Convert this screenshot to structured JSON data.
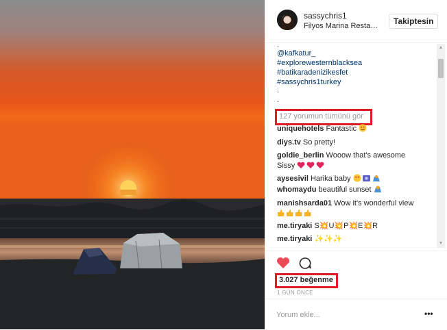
{
  "header": {
    "username": "sassychris1",
    "location": "Filyos Marina Restaurant",
    "follow_label": "Takiptesin"
  },
  "caption": {
    "lines": [
      ".",
      "@kafkatur_",
      "#explorewesternblacksea",
      "#batikaradenizikesfet",
      "#sassychris1turkey",
      ".",
      "."
    ]
  },
  "load_more": "127 yorumun tümünü gör",
  "comments": [
    {
      "user": "uniquehotels",
      "text": "Fantastic",
      "emoji": "heart-eyes"
    },
    {
      "user": "diys.tv",
      "text": "So pretty!",
      "emoji": ""
    },
    {
      "user": "goldie_berlin",
      "text": "Wooow that's awesome",
      "line2": "Sissy",
      "emoji": "hearts"
    },
    {
      "user": "aysesivil",
      "text": "Harika baby",
      "emoji": "heart-eyes-cam-flag"
    },
    {
      "user": "whomaydu",
      "text": "beautiful sunset",
      "emoji": "flag"
    },
    {
      "user": "manishsarda01",
      "text": "Wow it's wonderful view",
      "emoji": "thumbs"
    },
    {
      "user": "me.tiryaki",
      "text": "S💥U💥P💥E💥R",
      "emoji": ""
    },
    {
      "user": "me.tiryaki",
      "text": "✨✨✨",
      "emoji": ""
    }
  ],
  "likes": "3.027 beğenme",
  "time": "1 GÜN ÖNCE",
  "comment_placeholder": "Yorum ekle...",
  "more_label": "•••",
  "colors": {
    "accent_red": "#e01b23",
    "heart": "#ed4956",
    "link": "#003569"
  },
  "icons": {
    "like": "heart-icon",
    "comment": "comment-bubble-icon",
    "options": "more-options-icon"
  }
}
